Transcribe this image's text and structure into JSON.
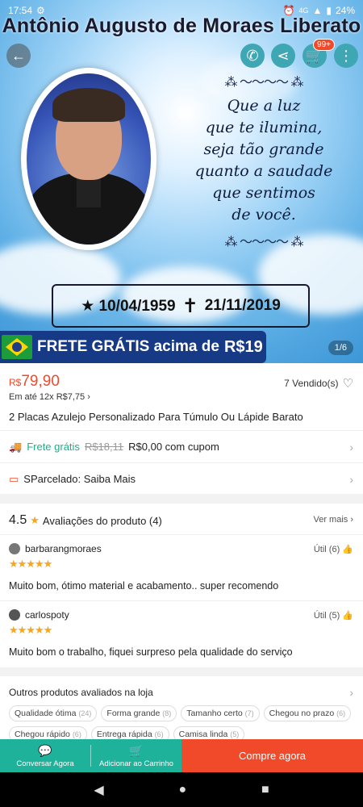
{
  "status_bar": {
    "time": "17:54",
    "battery": "24%",
    "network": "4G"
  },
  "hero": {
    "name": "Antônio Augusto de Moraes Liberato",
    "quote": "Que a luz\nque te ilumina,\nseja tão grande\nquanto a saudade\nque sentimos\nde você.",
    "ornament": "⁂ ～～～～ ⁂",
    "birth": "★ 10/04/1959",
    "cross": "✝",
    "death": "21/11/2019",
    "banner_text": "FRETE GRÁTIS acima de",
    "banner_amount": "R$19",
    "page_indicator": "1/6",
    "cart_badge": "99+"
  },
  "product": {
    "currency": "R$",
    "price": "79,90",
    "installments": "Em até 12x R$7,75",
    "sold": "7 Vendido(s)",
    "title": "2 Placas Azulejo Personalizado Para Túmulo Ou Lápide Barato",
    "shipping_label": "Frete grátis",
    "shipping_old": "R$18,11",
    "shipping_new": "R$0,00 com cupom",
    "parcelado": "SParcelado: Saiba Mais"
  },
  "reviews": {
    "score": "4.5",
    "label": "Avaliações do produto (4)",
    "see_more": "Ver mais",
    "items": [
      {
        "user": "barbarangmoraes",
        "useful": "Útil (6)",
        "stars": "★★★★★",
        "text": "Muito bom, ótimo material e acabamento.. super recomendo"
      },
      {
        "user": "carlospoty",
        "useful": "Útil (5)",
        "stars": "★★★★★",
        "text": "Muito bom o trabalho, fiquei surpreso pela qualidade do serviço"
      }
    ]
  },
  "other": {
    "title": "Outros produtos avaliados na loja",
    "tags": [
      {
        "label": "Qualidade ótima",
        "count": "(24)"
      },
      {
        "label": "Forma grande",
        "count": "(8)"
      },
      {
        "label": "Tamanho certo",
        "count": "(7)"
      },
      {
        "label": "Chegou no prazo",
        "count": "(6)"
      },
      {
        "label": "Chegou rápido",
        "count": "(6)"
      },
      {
        "label": "Entrega rápida",
        "count": "(6)"
      },
      {
        "label": "Camisa linda",
        "count": "(5)"
      }
    ]
  },
  "bottom": {
    "chat": "Conversar Agora",
    "cart": "Adicionar ao Carrinho",
    "buy": "Compre agora"
  },
  "colors": {
    "accent": "#f04a2a",
    "teal": "#1fb29a",
    "banner": "#173a86"
  }
}
